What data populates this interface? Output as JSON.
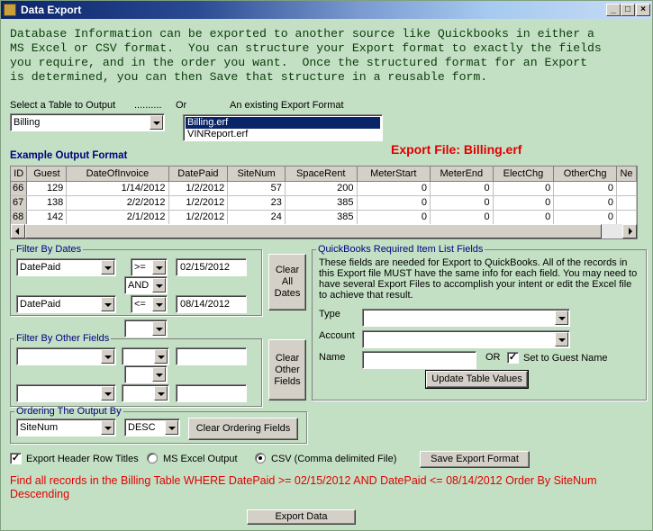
{
  "window": {
    "title": "Data Export",
    "controls": {
      "minimize": "_",
      "maximize": "□",
      "close": "×"
    }
  },
  "intro": "Database Information can be exported to another source like Quickbooks in either a\nMS Excel or CSV format.  You can structure your Export format to exactly the fields\nyou require, and in the order you want.  Once the structured format for an Export\nis determined, you can then Save that structure in a reusable form.",
  "select_table": {
    "label": "Select a Table to Output",
    "dots": "..........",
    "or": "Or",
    "value": "Billing"
  },
  "existing_format": {
    "label": "An existing Export Format",
    "items": [
      "Billing.erf",
      "VINReport.erf"
    ],
    "selected": "Billing.erf"
  },
  "export_file": "Export File: Billing.erf",
  "example_output": {
    "label": "Example Output Format",
    "columns": [
      "ID",
      "Guest",
      "DateOfInvoice",
      "DatePaid",
      "SiteNum",
      "SpaceRent",
      "MeterStart",
      "MeterEnd",
      "ElectChg",
      "OtherChg",
      "Ne"
    ],
    "rows": [
      [
        "66",
        "129",
        "1/14/2012",
        "1/2/2012",
        "57",
        "200",
        "0",
        "0",
        "0",
        "0",
        ""
      ],
      [
        "67",
        "138",
        "2/2/2012",
        "1/2/2012",
        "23",
        "385",
        "0",
        "0",
        "0",
        "0",
        ""
      ],
      [
        "68",
        "142",
        "2/1/2012",
        "1/2/2012",
        "24",
        "385",
        "0",
        "0",
        "0",
        "0",
        ""
      ]
    ]
  },
  "filter_dates": {
    "legend": "Filter By Dates",
    "field1": "DatePaid",
    "op1": ">=",
    "value1": "02/15/2012",
    "conjunction": "AND",
    "field2": "DatePaid",
    "op2": "<=",
    "value2": "08/14/2012",
    "clear_label": "Clear All Dates"
  },
  "filter_other": {
    "legend": "Filter By Other Fields",
    "clear_label": "Clear Other Fields"
  },
  "quickbooks": {
    "legend": "QuickBooks Required Item List Fields",
    "description": "These fields are needed for Export to QuickBooks.  All of the records in this Export file MUST have the same info for each field. You may need to have several Export Files to accomplish your intent or edit the Excel file to achieve that result.",
    "type_label": "Type",
    "account_label": "Account",
    "name_label": "Name",
    "or_label": "OR",
    "set_guest_label": "Set to Guest Name",
    "update_label": "Update Table Values"
  },
  "ordering": {
    "legend": "Ordering The Output By",
    "field": "SiteNum",
    "direction": "DESC",
    "clear_label": "Clear Ordering Fields"
  },
  "options": {
    "header_row_label": "Export Header Row Titles",
    "excel_label": "MS Excel Output",
    "csv_label": "CSV (Comma delimited File)",
    "save_label": "Save Export Format"
  },
  "query_text": "Find all records in the Billing Table  WHERE DatePaid >= 02/15/2012 AND DatePaid <= 08/14/2012 Order By SiteNum Descending",
  "export_button": "Export Data"
}
